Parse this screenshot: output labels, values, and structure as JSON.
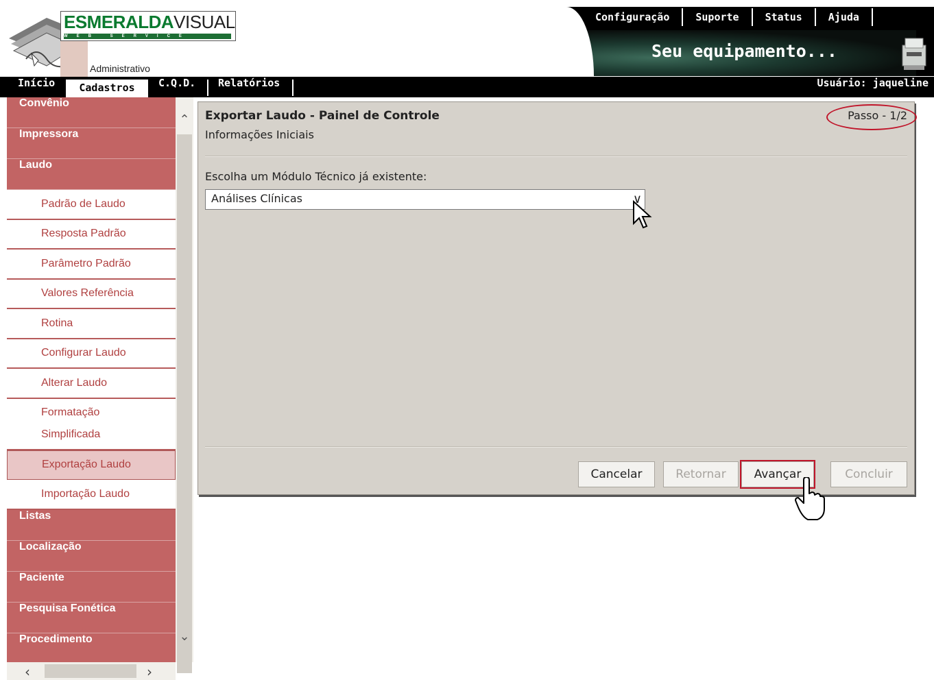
{
  "header": {
    "logo_main": "ESMERALDA",
    "logo_second": "VISUAL",
    "logo_tag": "WEB SERVICE",
    "module_label": "Administrativo",
    "banner_title": "Seu equipamento...",
    "top_menu": [
      "Configuração",
      "Suporte",
      "Status",
      "Ajuda"
    ]
  },
  "nav": {
    "items": [
      "Início",
      "Cadastros",
      "C.Q.D.",
      "Relatórios"
    ],
    "active": "Cadastros",
    "user_label": "Usuário: jaqueline"
  },
  "sidebar": {
    "categories_top": [
      "Convênio",
      "Impressora",
      "Laudo"
    ],
    "laudo_subitems": [
      "Padrão de Laudo",
      "Resposta Padrão",
      "Parâmetro Padrão",
      "Valores Referência",
      "Rotina",
      "Configurar Laudo",
      "Alterar Laudo",
      "Formatação Simplificada",
      "Exportação Laudo",
      "Importação Laudo"
    ],
    "selected": "Exportação Laudo",
    "categories_bottom": [
      "Listas",
      "Localização",
      "Paciente",
      "Pesquisa Fonética",
      "Procedimento"
    ]
  },
  "panel": {
    "title": "Exportar Laudo - Painel de Controle",
    "subtitle": "Informações Iniciais",
    "step": "Passo - 1/2",
    "field_label": "Escolha um Módulo Técnico já existente:",
    "select_value": "Análises Clínicas",
    "buttons": {
      "cancel": "Cancelar",
      "back": "Retornar",
      "next": "Avançar",
      "finish": "Concluir"
    }
  },
  "colors": {
    "sidebar_category": "#c26464",
    "sidebar_text": "#b04040",
    "panel_bg": "#d6d2cb",
    "highlight": "#c0152a"
  }
}
